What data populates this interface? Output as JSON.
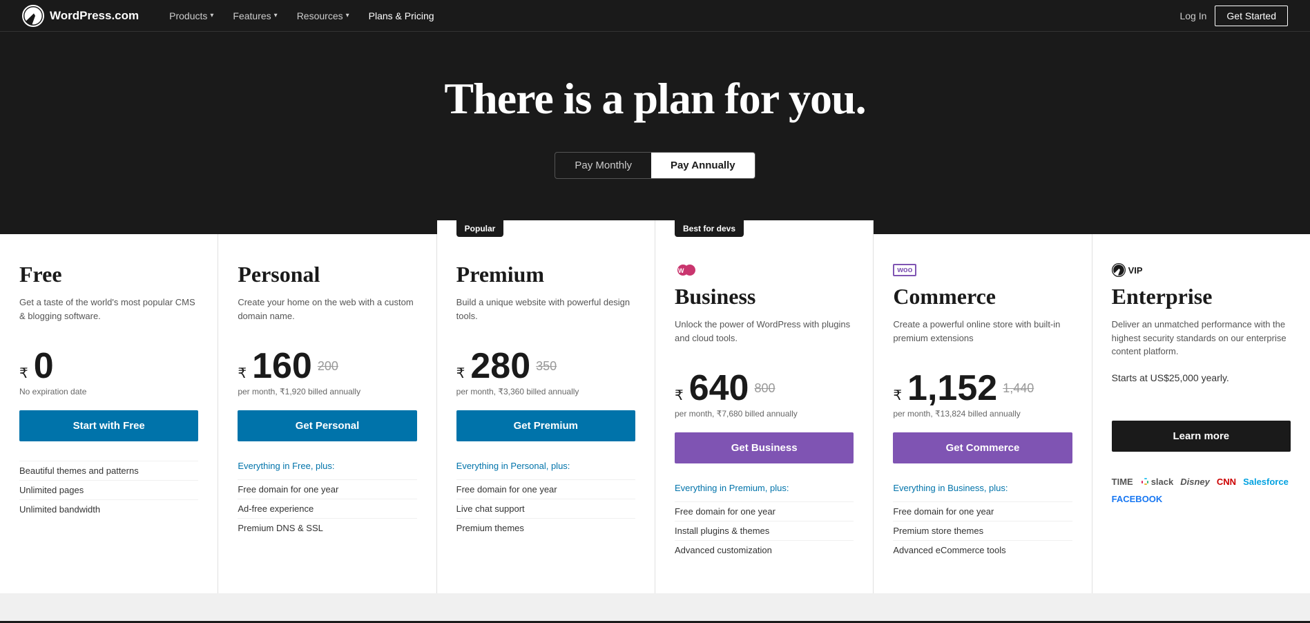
{
  "nav": {
    "logo_text": "WordPress.com",
    "links": [
      {
        "label": "Products",
        "has_dropdown": true
      },
      {
        "label": "Features",
        "has_dropdown": true
      },
      {
        "label": "Resources",
        "has_dropdown": true
      },
      {
        "label": "Plans & Pricing",
        "has_dropdown": false,
        "active": true
      }
    ],
    "login_label": "Log In",
    "get_started_label": "Get Started"
  },
  "hero": {
    "heading": "There is a plan for you.",
    "toggle": {
      "monthly_label": "Pay Monthly",
      "annually_label": "Pay Annually",
      "active": "annually"
    }
  },
  "plans": [
    {
      "id": "free",
      "badge": null,
      "icon": null,
      "name": "Free",
      "desc": "Get a taste of the world's most popular CMS & blogging software.",
      "currency": "₹",
      "price": "0",
      "original_price": null,
      "price_note": "No expiration date",
      "btn_label": "Start with Free",
      "btn_class": "btn-free",
      "features_header": null,
      "features": [
        "Beautiful themes and patterns",
        "Unlimited pages",
        "Unlimited bandwidth"
      ]
    },
    {
      "id": "personal",
      "badge": null,
      "icon": null,
      "name": "Personal",
      "desc": "Create your home on the web with a custom domain name.",
      "currency": "₹",
      "price": "160",
      "original_price": "200",
      "price_note": "per month, ₹1,920 billed annually",
      "btn_label": "Get Personal",
      "btn_class": "btn-personal",
      "features_header": "Everything in Free, plus:",
      "features": [
        "Free domain for one year",
        "Ad-free experience",
        "Premium DNS & SSL"
      ]
    },
    {
      "id": "premium",
      "badge": "Popular",
      "icon": null,
      "name": "Premium",
      "desc": "Build a unique website with powerful design tools.",
      "currency": "₹",
      "price": "280",
      "original_price": "350",
      "price_note": "per month, ₹3,360 billed annually",
      "btn_label": "Get Premium",
      "btn_class": "btn-premium",
      "features_header": "Everything in Personal, plus:",
      "features": [
        "Free domain for one year",
        "Live chat support",
        "Premium themes"
      ]
    },
    {
      "id": "business",
      "badge": "Best for devs",
      "icon": "wp",
      "name": "Business",
      "desc": "Unlock the power of WordPress with plugins and cloud tools.",
      "currency": "₹",
      "price": "640",
      "original_price": "800",
      "price_note": "per month, ₹7,680 billed annually",
      "btn_label": "Get Business",
      "btn_class": "btn-business",
      "features_header": "Everything in Premium, plus:",
      "features": [
        "Free domain for one year",
        "Install plugins & themes",
        "Advanced customization"
      ]
    },
    {
      "id": "commerce",
      "badge": null,
      "icon": "woo",
      "name": "Commerce",
      "desc": "Create a powerful online store with built-in premium extensions",
      "currency": "₹",
      "price": "1,152",
      "original_price": "1,440",
      "price_note": "per month, ₹13,824 billed annually",
      "btn_label": "Get Commerce",
      "btn_class": "btn-commerce",
      "features_header": "Everything in Business, plus:",
      "features": [
        "Free domain for one year",
        "Premium store themes",
        "Advanced eCommerce tools"
      ]
    },
    {
      "id": "enterprise",
      "badge": null,
      "icon": "vip",
      "name": "Enterprise",
      "desc": "Deliver an unmatched performance with the highest security standards on our enterprise content platform.",
      "currency": null,
      "price": null,
      "original_price": null,
      "price_note": "Starts at US$25,000 yearly.",
      "btn_label": "Learn more",
      "btn_class": "btn-enterprise",
      "features_header": null,
      "features": [],
      "brands": [
        "TIME",
        "slack",
        "Disney",
        "CNN",
        "Salesforce",
        "FACEBOOK"
      ]
    }
  ]
}
